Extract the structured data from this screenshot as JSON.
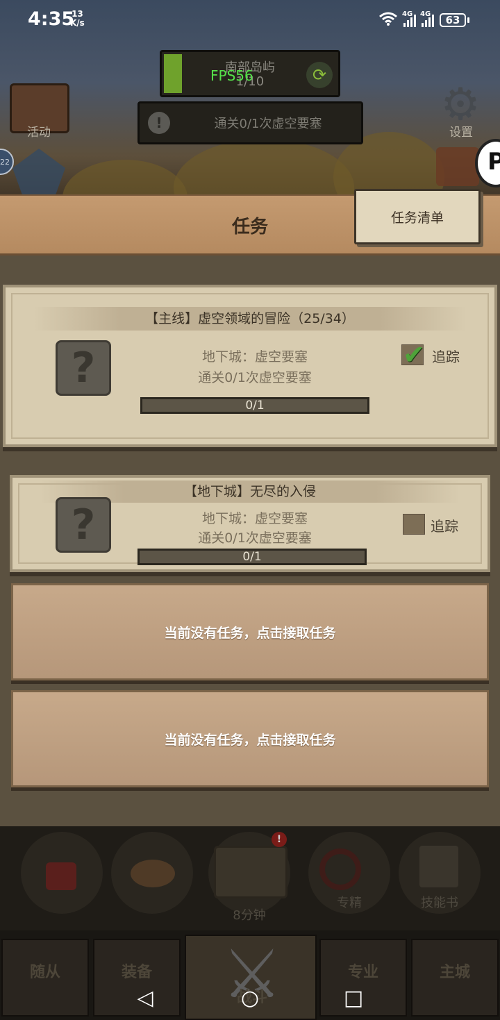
{
  "status_bar": {
    "time": "4:35",
    "net_speed_value": "13",
    "net_speed_unit": "K/s",
    "signal_1": "4G",
    "signal_2": "4G",
    "battery": "63"
  },
  "hud": {
    "region_name": "南部岛屿",
    "region_progress": "1/10",
    "fps": "FPS56",
    "quest_hint": "通关0/1次虚空要塞",
    "hint_icon": "!",
    "activity_label": "活动",
    "settings_label": "设置",
    "side_badge": "22"
  },
  "header": {
    "title": "任务",
    "list_button": "任务清单"
  },
  "quests": [
    {
      "title": "【主线】虚空领域的冒险（25/34）",
      "line1": "地下城：虚空要塞",
      "line2": "通关0/1次虚空要塞",
      "progress_text": "0/1",
      "progress": 0,
      "track_label": "追踪",
      "tracked": true
    },
    {
      "title": "【地下城】无尽的入侵",
      "line1": "地下城：虚空要塞",
      "line2": "通关0/1次虚空要塞",
      "progress_text": "0/1",
      "progress": 0,
      "track_label": "追踪",
      "tracked": false
    }
  ],
  "empty_slots": [
    {
      "text": "当前没有任务，点击接取任务"
    },
    {
      "text": "当前没有任务，点击接取任务"
    }
  ],
  "dock": {
    "chest_timer": "8分钟",
    "specialize_label": "专精",
    "skillbook_label": "技能书",
    "alert": "!"
  },
  "tabs": {
    "followers": "随从",
    "equipment": "装备",
    "battle": "战斗",
    "profession": "专业",
    "main_city": "主城"
  },
  "icons": {
    "question": "?",
    "check": "✔",
    "gear": "⚙",
    "refresh": "⟳",
    "swords": "⚔",
    "nav_back": "◁",
    "nav_home": "○",
    "nav_recent": "□"
  },
  "colors": {
    "fps_text": "#55e24a",
    "check": "#4fa33a",
    "panel": "#d8ccb0",
    "header": "#c49a70"
  }
}
